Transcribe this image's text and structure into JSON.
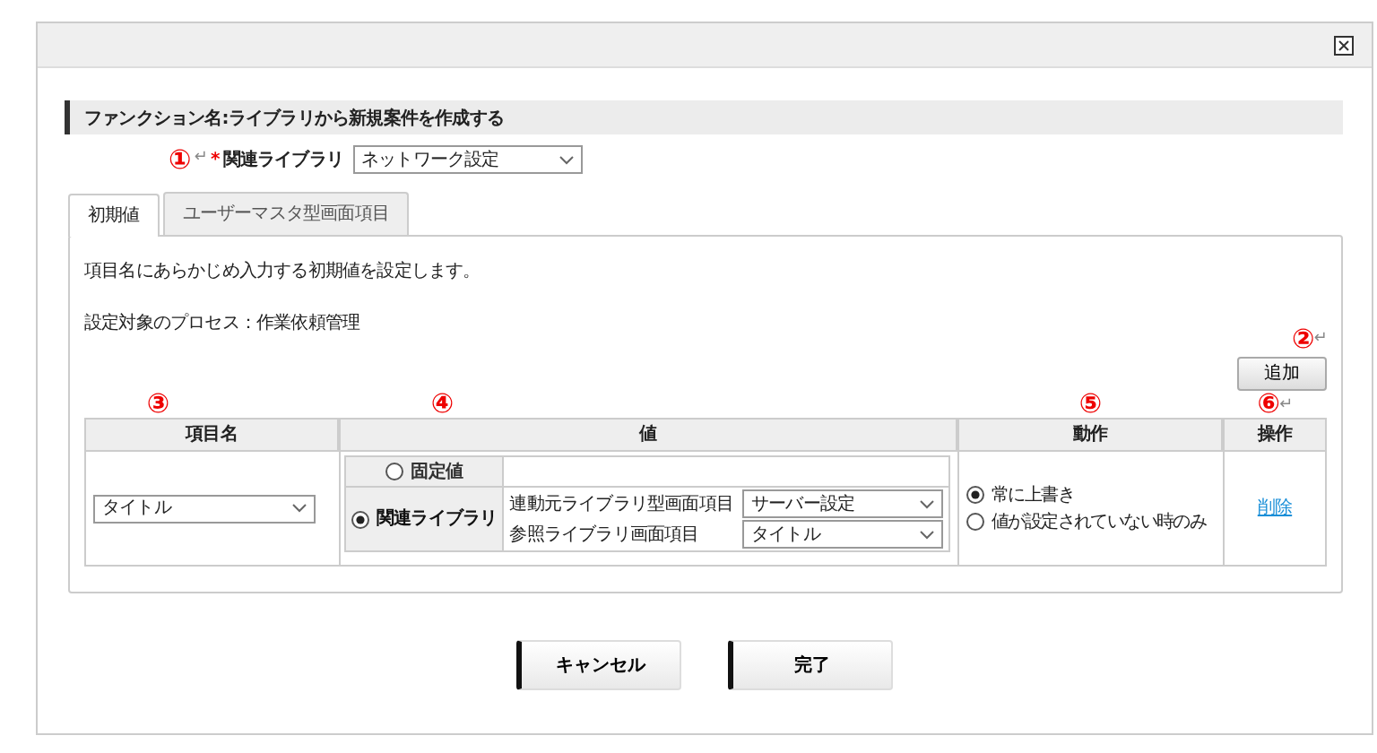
{
  "section_title": "ファンクション名:ライブラリから新規案件を作成する",
  "library_field": {
    "marker": "①",
    "return_mark": "↵",
    "required_mark": "*",
    "label": "関連ライブラリ",
    "value": "ネットワーク設定"
  },
  "tabs": [
    {
      "label": "初期値",
      "selected": true
    },
    {
      "label": "ユーザーマスタ型画面項目",
      "selected": false
    }
  ],
  "description": "項目名にあらかじめ入力する初期値を設定します。",
  "process": "設定対象のプロセス：作業依頼管理",
  "add_button": {
    "marker": "②",
    "return_mark": "↵",
    "label": "追加"
  },
  "table": {
    "columns": [
      {
        "label": "項目名",
        "marker": "③"
      },
      {
        "label": "値",
        "marker": "④"
      },
      {
        "label": "動作",
        "marker": "⑤"
      },
      {
        "label": "操作",
        "marker": "⑥",
        "return_mark": "↵"
      }
    ],
    "rows": [
      {
        "item": "タイトル",
        "value_options": [
          {
            "label": "固定値",
            "selected": false
          },
          {
            "label": "関連ライブラリ",
            "selected": true,
            "fields": [
              {
                "label": "連動元ライブラリ型画面項目",
                "value": "サーバー設定"
              },
              {
                "label": "参照ライブラリ画面項目",
                "value": "タイトル"
              }
            ]
          }
        ],
        "actions": [
          {
            "label": "常に上書き",
            "selected": true
          },
          {
            "label": "値が設定されていない時のみ",
            "selected": false
          }
        ],
        "delete_link": "削除"
      }
    ]
  },
  "buttons": [
    "キャンセル",
    "完了"
  ]
}
